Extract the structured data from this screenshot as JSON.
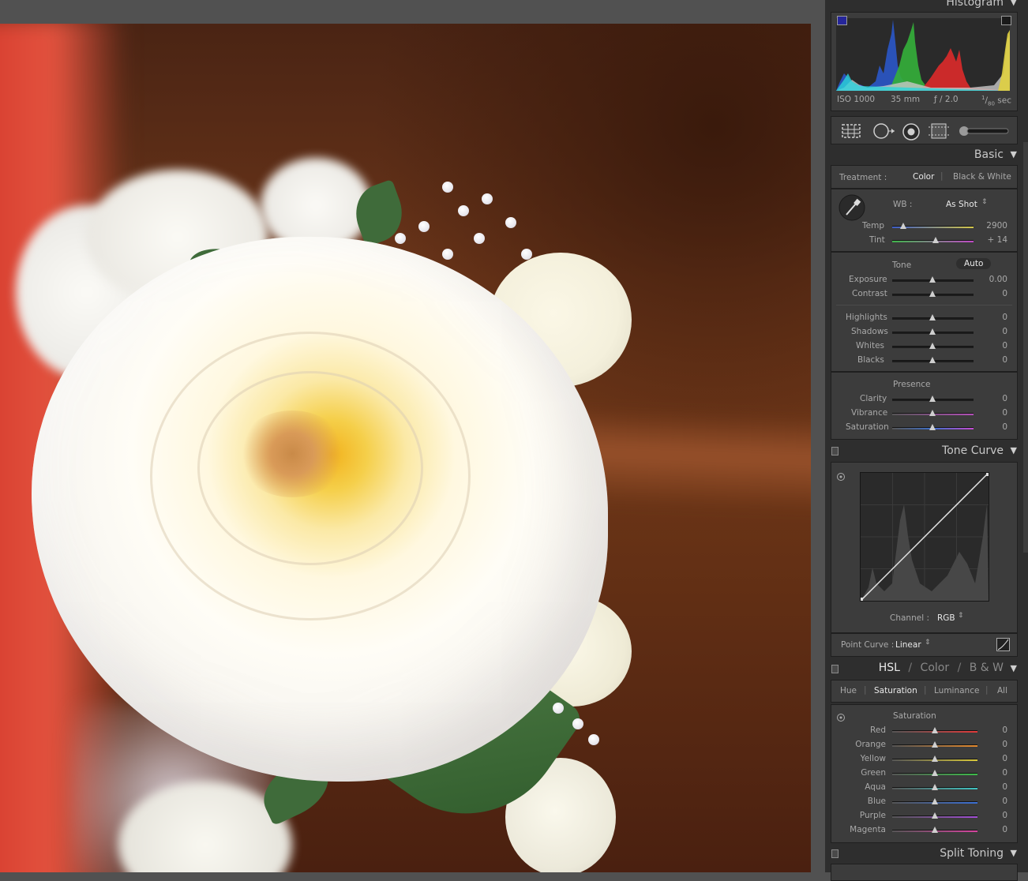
{
  "panel": {
    "histogram": {
      "title": "Histogram",
      "iso": "ISO 1000",
      "focal": "35 mm",
      "aperture": "ƒ / 2.0",
      "shutter_num": "1",
      "shutter_den": "80",
      "shutter_unit": " sec"
    },
    "basic": {
      "title": "Basic",
      "treatment_label": "Treatment :",
      "treatment_color": "Color",
      "treatment_bw": "Black & White",
      "wb_label": "WB :",
      "wb_value": "As Shot",
      "temp_label": "Temp",
      "temp_value": "2900",
      "tint_label": "Tint",
      "tint_value": "+ 14",
      "tone_label": "Tone",
      "auto_label": "Auto",
      "exposure_label": "Exposure",
      "exposure_value": "0.00",
      "contrast_label": "Contrast",
      "contrast_value": "0",
      "highlights_label": "Highlights",
      "highlights_value": "0",
      "shadows_label": "Shadows",
      "shadows_value": "0",
      "whites_label": "Whites",
      "whites_value": "0",
      "blacks_label": "Blacks",
      "blacks_value": "0",
      "presence_label": "Presence",
      "clarity_label": "Clarity",
      "clarity_value": "0",
      "vibrance_label": "Vibrance",
      "vibrance_value": "0",
      "saturation_label": "Saturation",
      "saturation_value": "0"
    },
    "tone_curve": {
      "title": "Tone Curve",
      "channel_label": "Channel :",
      "channel_value": "RGB",
      "point_curve_label": "Point Curve :",
      "point_curve_value": "Linear"
    },
    "hsl": {
      "title_hsl": "HSL",
      "title_color": "Color",
      "title_bw": "B & W",
      "slash": "/",
      "tabs": [
        "Hue",
        "Saturation",
        "Luminance",
        "All"
      ],
      "section": "Saturation",
      "rows": [
        {
          "label": "Red",
          "value": "0"
        },
        {
          "label": "Orange",
          "value": "0"
        },
        {
          "label": "Yellow",
          "value": "0"
        },
        {
          "label": "Green",
          "value": "0"
        },
        {
          "label": "Aqua",
          "value": "0"
        },
        {
          "label": "Blue",
          "value": "0"
        },
        {
          "label": "Purple",
          "value": "0"
        },
        {
          "label": "Magenta",
          "value": "0"
        }
      ]
    },
    "split_toning": {
      "title": "Split Toning"
    }
  },
  "colors": {
    "panel_bg": "#2e2e2e",
    "section_bg": "#3c3c3c",
    "text": "#a9a9a9",
    "active_text": "#e9e9e9"
  }
}
